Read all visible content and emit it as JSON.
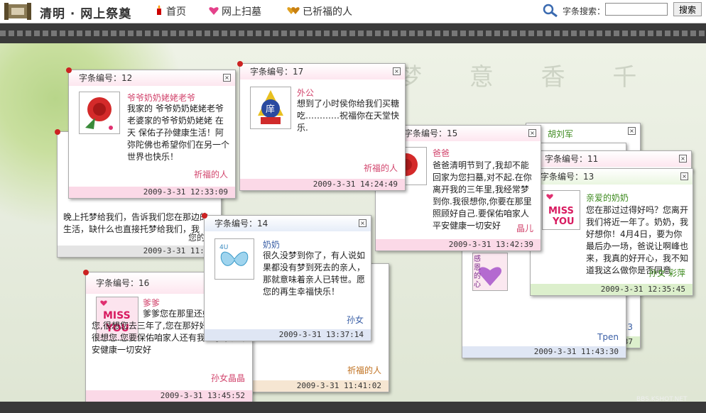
{
  "header": {
    "site_title": "清明 · 网上祭奠",
    "nav": [
      {
        "label": "首页",
        "icon": "candle-icon"
      },
      {
        "label": "网上扫墓",
        "icon": "heart-icon"
      },
      {
        "label": "已祈福的人",
        "icon": "double-heart-icon"
      }
    ],
    "search_label": "字条搜索：",
    "search_value": "",
    "search_button": "搜索"
  },
  "watermark": "BBS.KSHOT.NET",
  "cards": {
    "c12": {
      "id_label": "字条编号：12",
      "name": "爷爷奶奶姥姥老爷",
      "msg": "我家的  爷爷奶奶姥姥老爷  老婆家的爷爷奶奶姥姥  在天  保佑子孙健康生活！阿弥陀佛也希望你们在另一个世界也快乐！",
      "sign": "祈福的人",
      "date": "2009-3-31 12:33:09"
    },
    "c17": {
      "id_label": "字条编号：17",
      "name": "外公",
      "msg": "想到了小时侯你给我们买糖吃…………祝福你在天堂快乐.",
      "sign": "祈福的人",
      "date": "2009-3-31 14:24:49"
    },
    "c15": {
      "id_label": "字条编号：15",
      "name": "爸爸",
      "msg": "爸爸清明节到了,我却不能回家为您扫墓,对不起.在你离开我的三年里,我经常梦到你.我很想你,你要在那里照顾好自己.要保佑咱家人平安健康一切安好",
      "sign": "晶儿",
      "date": "2009-3-31 13:42:39"
    },
    "c11": {
      "id_label": "字条编号：11"
    },
    "c13": {
      "id_label": "字条编号：13",
      "name": "亲爱的奶奶",
      "msg": "您在那过过得好吗？您离开我们将近一年了。奶奶，我好想你！4月4日，要为你最后办一场，爸说让啊峰也来，我真的好开心，我不知道我这么做你是否同意",
      "sign": "孙女  彩萍",
      "date": "2009-3-31 12:35:45"
    },
    "back_left": {
      "msg": "晚上托梦给我们，告诉我们您在那边的生活，缺什么也直接托梦给我们，我",
      "sign": "您的女",
      "date": "2009-3-31 11:43"
    },
    "c14": {
      "id_label": "字条编号：14",
      "name": "奶奶",
      "msg": "很久没梦到你了，有人说如果都没有梦到死去的亲人，那就意味着亲人已转世。愿您的再生幸福快乐！",
      "sign": "孙女",
      "date": "2009-3-31 13:37:14"
    },
    "c16": {
      "id_label": "字条编号：16",
      "name": "爹爹",
      "msg": "爹爹您在那里还好吗常梦见您,很想您去三年了,您在那好好的.我们都很想您.您要保佑咱家人还有我的小家庭平安健康一切安好",
      "sign": "孙女晶晶",
      "date": "2009-3-31 13:45:52"
    },
    "back_orange": {
      "sign": "祈福的人",
      "date": "2009-3-31 11:41:02"
    },
    "back_right": {
      "sign": "Tpen",
      "date": "2009-3-31 11:43:30",
      "pic_text": "感恩的心"
    },
    "back_green": {
      "sign": "2323",
      "date": "11:41:37",
      "partial_name": "胡刘军"
    }
  },
  "colors": {
    "pink_name": "#d2456d",
    "blue_name": "#3a5fa6",
    "green_name": "#3d8a1e"
  }
}
